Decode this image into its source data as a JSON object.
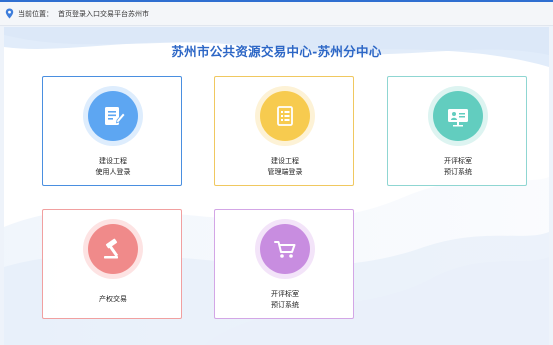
{
  "breadcrumb": {
    "prefix": "当前位置：",
    "path": "首页登录入口交易平台苏州市"
  },
  "page": {
    "title": "苏州市公共资源交易中心-苏州分中心"
  },
  "cards": [
    {
      "line1": "建设工程",
      "line2": "使用人登录",
      "icon": "edit-document-icon",
      "color": "#5da6f2",
      "border": "#4a8fe0"
    },
    {
      "line1": "建设工程",
      "line2": "管理端登录",
      "icon": "document-list-icon",
      "color": "#f7cb4f",
      "border": "#f0c860"
    },
    {
      "line1": "开评标室",
      "line2": "预订系统",
      "icon": "presentation-screen-icon",
      "color": "#62cdbf",
      "border": "#8fd6d2"
    },
    {
      "line1": "产权交易",
      "line2": "",
      "icon": "gavel-icon",
      "color": "#f08a8a",
      "border": "#f1a0a0"
    },
    {
      "line1": "开评标室",
      "line2": "预订系统",
      "icon": "shopping-cart-icon",
      "color": "#c88de0",
      "border": "#d3a6e6"
    }
  ]
}
